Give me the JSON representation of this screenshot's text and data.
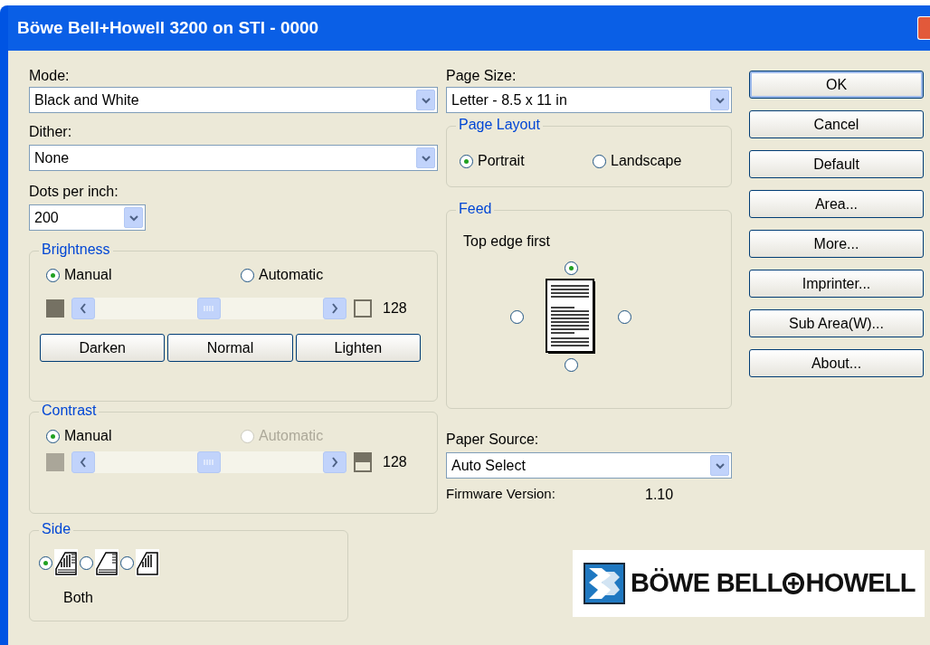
{
  "window": {
    "title": "Böwe Bell+Howell 3200 on STI - 0000"
  },
  "mode": {
    "label": "Mode:",
    "value": "Black and White"
  },
  "dither": {
    "label": "Dither:",
    "value": "None"
  },
  "dpi": {
    "label": "Dots per inch:",
    "value": "200"
  },
  "brightness": {
    "title": "Brightness",
    "options": [
      {
        "label": "Manual",
        "selected": true,
        "disabled": false
      },
      {
        "label": "Automatic",
        "selected": false,
        "disabled": false
      }
    ],
    "level": 0.5,
    "reading": "128",
    "buttons": [
      "Darken",
      "Normal",
      "Lighten"
    ]
  },
  "contrast": {
    "title": "Contrast",
    "options": [
      {
        "label": "Manual",
        "selected": true,
        "disabled": false
      },
      {
        "label": "Automatic",
        "selected": false,
        "disabled": true
      }
    ],
    "level": 0.5,
    "reading": "128"
  },
  "side": {
    "title": "Side",
    "options": [
      {
        "kind": "both",
        "selected": true
      },
      {
        "kind": "front",
        "selected": false
      },
      {
        "kind": "back",
        "selected": false
      }
    ],
    "caption": "Both"
  },
  "page_size": {
    "label": "Page Size:",
    "value": "Letter - 8.5 x 11 in"
  },
  "page_layout": {
    "title": "Page Layout",
    "options": [
      {
        "label": "Portrait",
        "selected": true
      },
      {
        "label": "Landscape",
        "selected": false
      }
    ]
  },
  "feed": {
    "title": "Feed",
    "caption": "Top edge first",
    "options": [
      {
        "kind": "top",
        "selected": true
      },
      {
        "kind": "left",
        "selected": false
      },
      {
        "kind": "right",
        "selected": false
      },
      {
        "kind": "bottom",
        "selected": false
      }
    ]
  },
  "paper_source": {
    "label": "Paper Source:",
    "value": "Auto Select"
  },
  "firmware": {
    "label": "Firmware Version:",
    "value": "1.10"
  },
  "buttons": [
    {
      "label": "OK",
      "default": true
    },
    {
      "label": "Cancel",
      "default": false
    },
    {
      "label": "Default",
      "default": false
    },
    {
      "label": "Area...",
      "default": false
    },
    {
      "label": "More...",
      "default": false
    },
    {
      "label": "Imprinter...",
      "default": false
    },
    {
      "label": "Sub Area(W)...",
      "default": false
    },
    {
      "label": "About...",
      "default": false
    }
  ],
  "logo": {
    "left": "BÖWE BELL",
    "right": "HOWELL"
  }
}
